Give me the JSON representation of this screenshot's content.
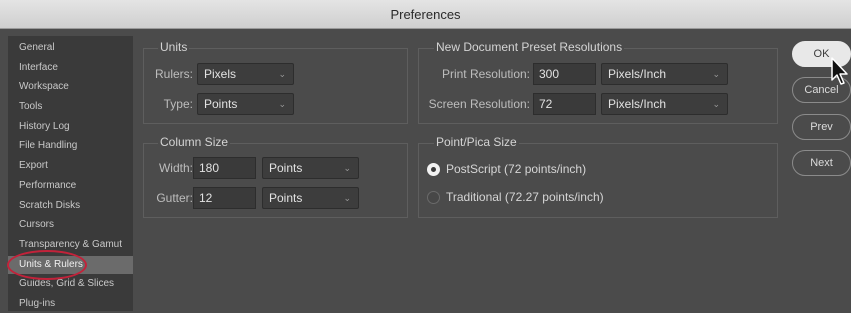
{
  "window": {
    "title": "Preferences"
  },
  "sidebar": {
    "items": [
      {
        "label": "General"
      },
      {
        "label": "Interface"
      },
      {
        "label": "Workspace"
      },
      {
        "label": "Tools"
      },
      {
        "label": "History Log"
      },
      {
        "label": "File Handling"
      },
      {
        "label": "Export"
      },
      {
        "label": "Performance"
      },
      {
        "label": "Scratch Disks"
      },
      {
        "label": "Cursors"
      },
      {
        "label": "Transparency & Gamut"
      },
      {
        "label": "Units & Rulers"
      },
      {
        "label": "Guides, Grid & Slices"
      },
      {
        "label": "Plug-ins"
      }
    ],
    "selected": "Units & Rulers"
  },
  "units": {
    "title": "Units",
    "rulers_label": "Rulers:",
    "rulers_value": "Pixels",
    "type_label": "Type:",
    "type_value": "Points"
  },
  "column_size": {
    "title": "Column Size",
    "width_label": "Width:",
    "width_value": "180",
    "width_unit": "Points",
    "gutter_label": "Gutter:",
    "gutter_value": "12",
    "gutter_unit": "Points"
  },
  "preset_resolutions": {
    "title": "New Document Preset Resolutions",
    "print_label": "Print Resolution:",
    "print_value": "300",
    "print_unit": "Pixels/Inch",
    "screen_label": "Screen Resolution:",
    "screen_value": "72",
    "screen_unit": "Pixels/Inch"
  },
  "point_pica": {
    "title": "Point/Pica Size",
    "postscript_label": "PostScript (72 points/inch)",
    "traditional_label": "Traditional (72.27 points/inch)",
    "selected": "postscript"
  },
  "buttons": {
    "ok": "OK",
    "cancel": "Cancel",
    "prev": "Prev",
    "next": "Next"
  },
  "colors": {
    "highlight_circle": "#c3223a",
    "panel": "#4b4b4b",
    "sidebar": "#3a3a3a"
  }
}
